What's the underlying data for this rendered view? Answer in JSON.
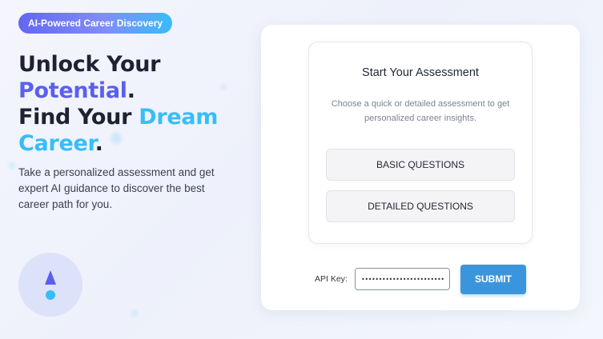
{
  "hero": {
    "badge": "AI-Powered Career Discovery",
    "headline": {
      "line1": "Unlock Your",
      "line2_highlight": "Potential",
      "line2_end": ".",
      "line3_start": "Find Your ",
      "line3_highlight": "Dream",
      "line4_highlight": "Career",
      "line4_end": "."
    },
    "subtext": "Take a personalized assessment and get expert AI guidance to discover the best career path for you."
  },
  "assessment": {
    "title": "Start Your Assessment",
    "description": "Choose a quick or detailed assessment to get personalized career insights.",
    "basic_button": "BASIC QUESTIONS",
    "detailed_button": "DETAILED QUESTIONS"
  },
  "api": {
    "label": "API Key:",
    "value": "••••••••••••••••••••••••••••••••••"
  },
  "submit_label": "SUBMIT",
  "colors": {
    "accent_purple": "#5b5ff0",
    "accent_blue": "#38bdf8",
    "submit_blue": "#3b95dd"
  },
  "icons": {
    "brand": "brand-logo-icon"
  }
}
